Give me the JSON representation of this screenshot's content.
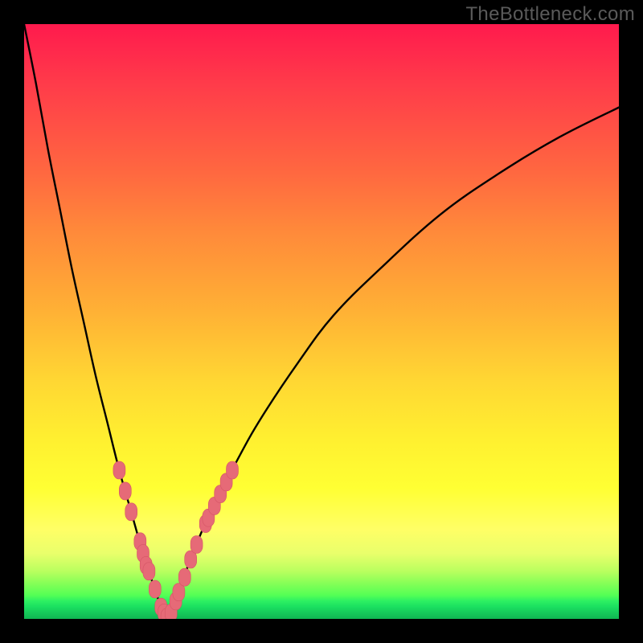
{
  "watermark": "TheBottleneck.com",
  "colors": {
    "background": "#000000",
    "gradient_top": "#ff1a4d",
    "gradient_mid": "#ffff33",
    "gradient_bottom": "#10b653",
    "curve": "#000000",
    "marker": "#e66a77"
  },
  "chart_data": {
    "type": "line",
    "title": "",
    "xlabel": "",
    "ylabel": "",
    "xlim": [
      0,
      100
    ],
    "ylim": [
      0,
      100
    ],
    "grid": false,
    "legend": false,
    "x_min_position": 24,
    "series": [
      {
        "name": "curve",
        "x": [
          0,
          2,
          4,
          6,
          8,
          10,
          12,
          14,
          16,
          18,
          20,
          22,
          24,
          26,
          28,
          30,
          32,
          36,
          40,
          46,
          52,
          60,
          70,
          80,
          90,
          100
        ],
        "y": [
          100,
          90,
          79,
          69,
          59,
          50,
          41,
          33,
          25,
          18,
          11,
          5,
          0,
          5,
          10,
          15,
          19,
          27,
          34,
          43,
          51,
          59,
          68,
          75,
          81,
          86
        ]
      }
    ],
    "markers": {
      "name": "highlight-points",
      "shape": "rounded-rect",
      "points": [
        {
          "x": 16.0,
          "y": 25.0
        },
        {
          "x": 17.0,
          "y": 21.5
        },
        {
          "x": 18.0,
          "y": 18.0
        },
        {
          "x": 19.5,
          "y": 13.0
        },
        {
          "x": 20.0,
          "y": 11.0
        },
        {
          "x": 20.5,
          "y": 9.0
        },
        {
          "x": 21.0,
          "y": 8.0
        },
        {
          "x": 22.0,
          "y": 5.0
        },
        {
          "x": 23.0,
          "y": 2.0
        },
        {
          "x": 23.5,
          "y": 1.0
        },
        {
          "x": 24.0,
          "y": 0.3
        },
        {
          "x": 24.7,
          "y": 1.0
        },
        {
          "x": 25.5,
          "y": 3.0
        },
        {
          "x": 26.0,
          "y": 4.5
        },
        {
          "x": 27.0,
          "y": 7.0
        },
        {
          "x": 28.0,
          "y": 10.0
        },
        {
          "x": 29.0,
          "y": 12.5
        },
        {
          "x": 30.5,
          "y": 16.0
        },
        {
          "x": 31.0,
          "y": 17.0
        },
        {
          "x": 32.0,
          "y": 19.0
        },
        {
          "x": 33.0,
          "y": 21.0
        },
        {
          "x": 34.0,
          "y": 23.0
        },
        {
          "x": 35.0,
          "y": 25.0
        }
      ]
    }
  }
}
